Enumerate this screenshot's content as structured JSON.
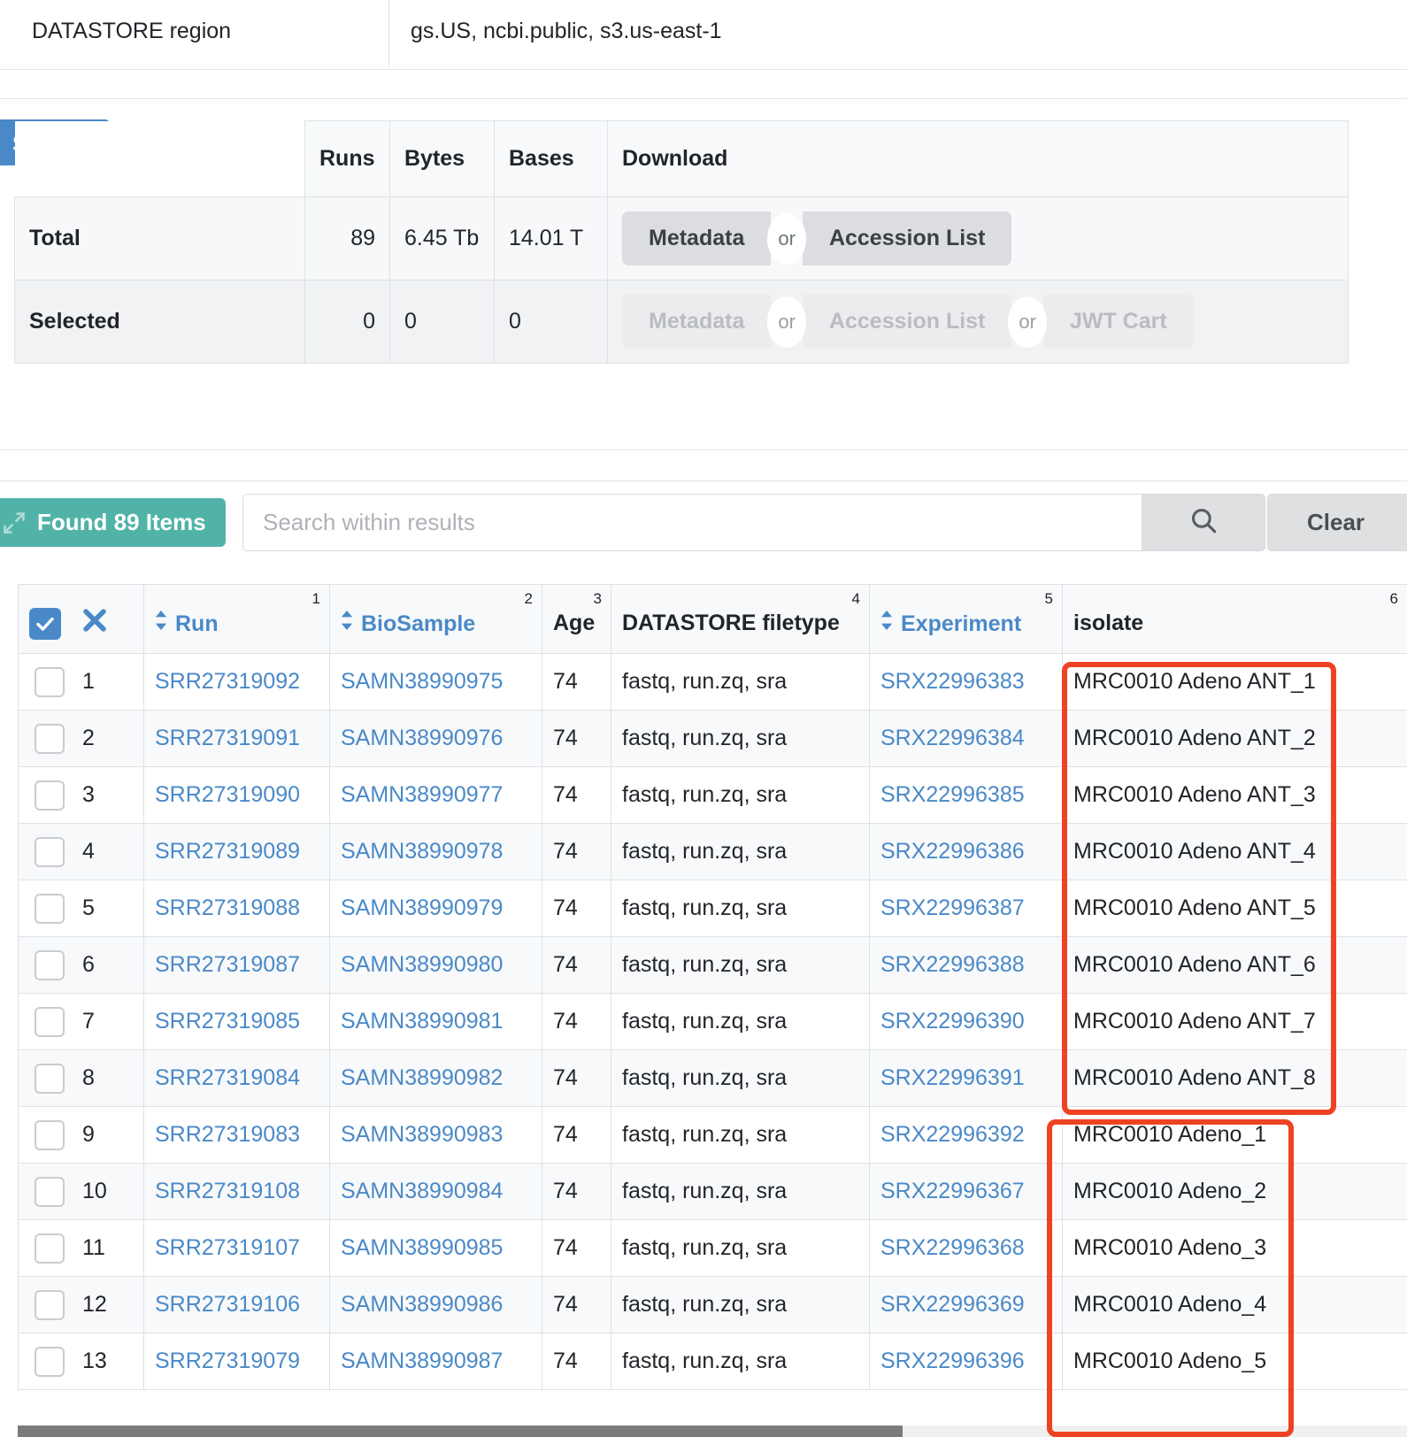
{
  "top_strip": {
    "label": "DATASTORE region",
    "value": "gs.US, ncbi.public, s3.us-east-1"
  },
  "select_button": {
    "label": "Select"
  },
  "summary_table": {
    "headers": [
      "",
      "Runs",
      "Bytes",
      "Bases",
      "Download"
    ],
    "rows": [
      {
        "label": "Total",
        "runs": "89",
        "bytes": "6.45 Tb",
        "bases": "14.01 T",
        "download": {
          "metadata": "Metadata",
          "or1": "or",
          "accession_list": "Accession List",
          "or2": "",
          "jwt_cart": "",
          "enabled": true
        }
      },
      {
        "label": "Selected",
        "runs": "0",
        "bytes": "0",
        "bases": "0",
        "download": {
          "metadata": "Metadata",
          "or1": "or",
          "accession_list": "Accession List",
          "or2": "or",
          "jwt_cart": "JWT Cart",
          "enabled": false
        }
      }
    ]
  },
  "results_toolbar": {
    "found_badge": "Found 89 Items",
    "found_icon": "expand-arrows-icon",
    "search_placeholder": "Search within results",
    "search_value": "",
    "search_icon": "search-icon",
    "clear_label": "Clear"
  },
  "results_table": {
    "select_all_icon": "checkbox-checked-icon",
    "clear_all_icon": "x-mark-icon",
    "columns": [
      {
        "label": "",
        "num": "",
        "sortable": false,
        "link": false
      },
      {
        "label": "Run",
        "num": "1",
        "sortable": true,
        "link": true
      },
      {
        "label": "BioSample",
        "num": "2",
        "sortable": true,
        "link": true
      },
      {
        "label": "Age",
        "num": "3",
        "sortable": false,
        "link": false
      },
      {
        "label": "DATASTORE filetype",
        "num": "4",
        "sortable": false,
        "link": false
      },
      {
        "label": "Experiment",
        "num": "5",
        "sortable": true,
        "link": true
      },
      {
        "label": "isolate",
        "num": "6",
        "sortable": false,
        "link": false
      }
    ],
    "rows": [
      {
        "index": "1",
        "run": "SRR27319092",
        "biosample": "SAMN38990975",
        "age": "74",
        "filetype": "fastq, run.zq, sra",
        "experiment": "SRX22996383",
        "isolate": "MRC0010 Adeno ANT_1"
      },
      {
        "index": "2",
        "run": "SRR27319091",
        "biosample": "SAMN38990976",
        "age": "74",
        "filetype": "fastq, run.zq, sra",
        "experiment": "SRX22996384",
        "isolate": "MRC0010 Adeno ANT_2"
      },
      {
        "index": "3",
        "run": "SRR27319090",
        "biosample": "SAMN38990977",
        "age": "74",
        "filetype": "fastq, run.zq, sra",
        "experiment": "SRX22996385",
        "isolate": "MRC0010 Adeno ANT_3"
      },
      {
        "index": "4",
        "run": "SRR27319089",
        "biosample": "SAMN38990978",
        "age": "74",
        "filetype": "fastq, run.zq, sra",
        "experiment": "SRX22996386",
        "isolate": "MRC0010 Adeno ANT_4"
      },
      {
        "index": "5",
        "run": "SRR27319088",
        "biosample": "SAMN38990979",
        "age": "74",
        "filetype": "fastq, run.zq, sra",
        "experiment": "SRX22996387",
        "isolate": "MRC0010 Adeno ANT_5"
      },
      {
        "index": "6",
        "run": "SRR27319087",
        "biosample": "SAMN38990980",
        "age": "74",
        "filetype": "fastq, run.zq, sra",
        "experiment": "SRX22996388",
        "isolate": "MRC0010 Adeno ANT_6"
      },
      {
        "index": "7",
        "run": "SRR27319085",
        "biosample": "SAMN38990981",
        "age": "74",
        "filetype": "fastq, run.zq, sra",
        "experiment": "SRX22996390",
        "isolate": "MRC0010 Adeno ANT_7"
      },
      {
        "index": "8",
        "run": "SRR27319084",
        "biosample": "SAMN38990982",
        "age": "74",
        "filetype": "fastq, run.zq, sra",
        "experiment": "SRX22996391",
        "isolate": "MRC0010 Adeno ANT_8"
      },
      {
        "index": "9",
        "run": "SRR27319083",
        "biosample": "SAMN38990983",
        "age": "74",
        "filetype": "fastq, run.zq, sra",
        "experiment": "SRX22996392",
        "isolate": "MRC0010 Adeno_1"
      },
      {
        "index": "10",
        "run": "SRR27319108",
        "biosample": "SAMN38990984",
        "age": "74",
        "filetype": "fastq, run.zq, sra",
        "experiment": "SRX22996367",
        "isolate": "MRC0010 Adeno_2"
      },
      {
        "index": "11",
        "run": "SRR27319107",
        "biosample": "SAMN38990985",
        "age": "74",
        "filetype": "fastq, run.zq, sra",
        "experiment": "SRX22996368",
        "isolate": "MRC0010 Adeno_3"
      },
      {
        "index": "12",
        "run": "SRR27319106",
        "biosample": "SAMN38990986",
        "age": "74",
        "filetype": "fastq, run.zq, sra",
        "experiment": "SRX22996369",
        "isolate": "MRC0010 Adeno_4"
      },
      {
        "index": "13",
        "run": "SRR27319079",
        "biosample": "SAMN38990987",
        "age": "74",
        "filetype": "fastq, run.zq, sra",
        "experiment": "SRX22996396",
        "isolate": "MRC0010 Adeno_5"
      }
    ]
  },
  "annotations": {
    "box_color": "#ee4323",
    "boxes": [
      {
        "name": "isolate-ant-group-highlight",
        "covers_rows": "1-8"
      },
      {
        "name": "isolate-adeno-group-highlight",
        "covers_rows": "9-13"
      }
    ]
  },
  "colors": {
    "primary_blue": "#4a89c8",
    "badge_teal": "#51b3a8",
    "link_blue": "#4a89c8",
    "highlight_red": "#ee4323",
    "header_bg": "#f8f9fa"
  }
}
